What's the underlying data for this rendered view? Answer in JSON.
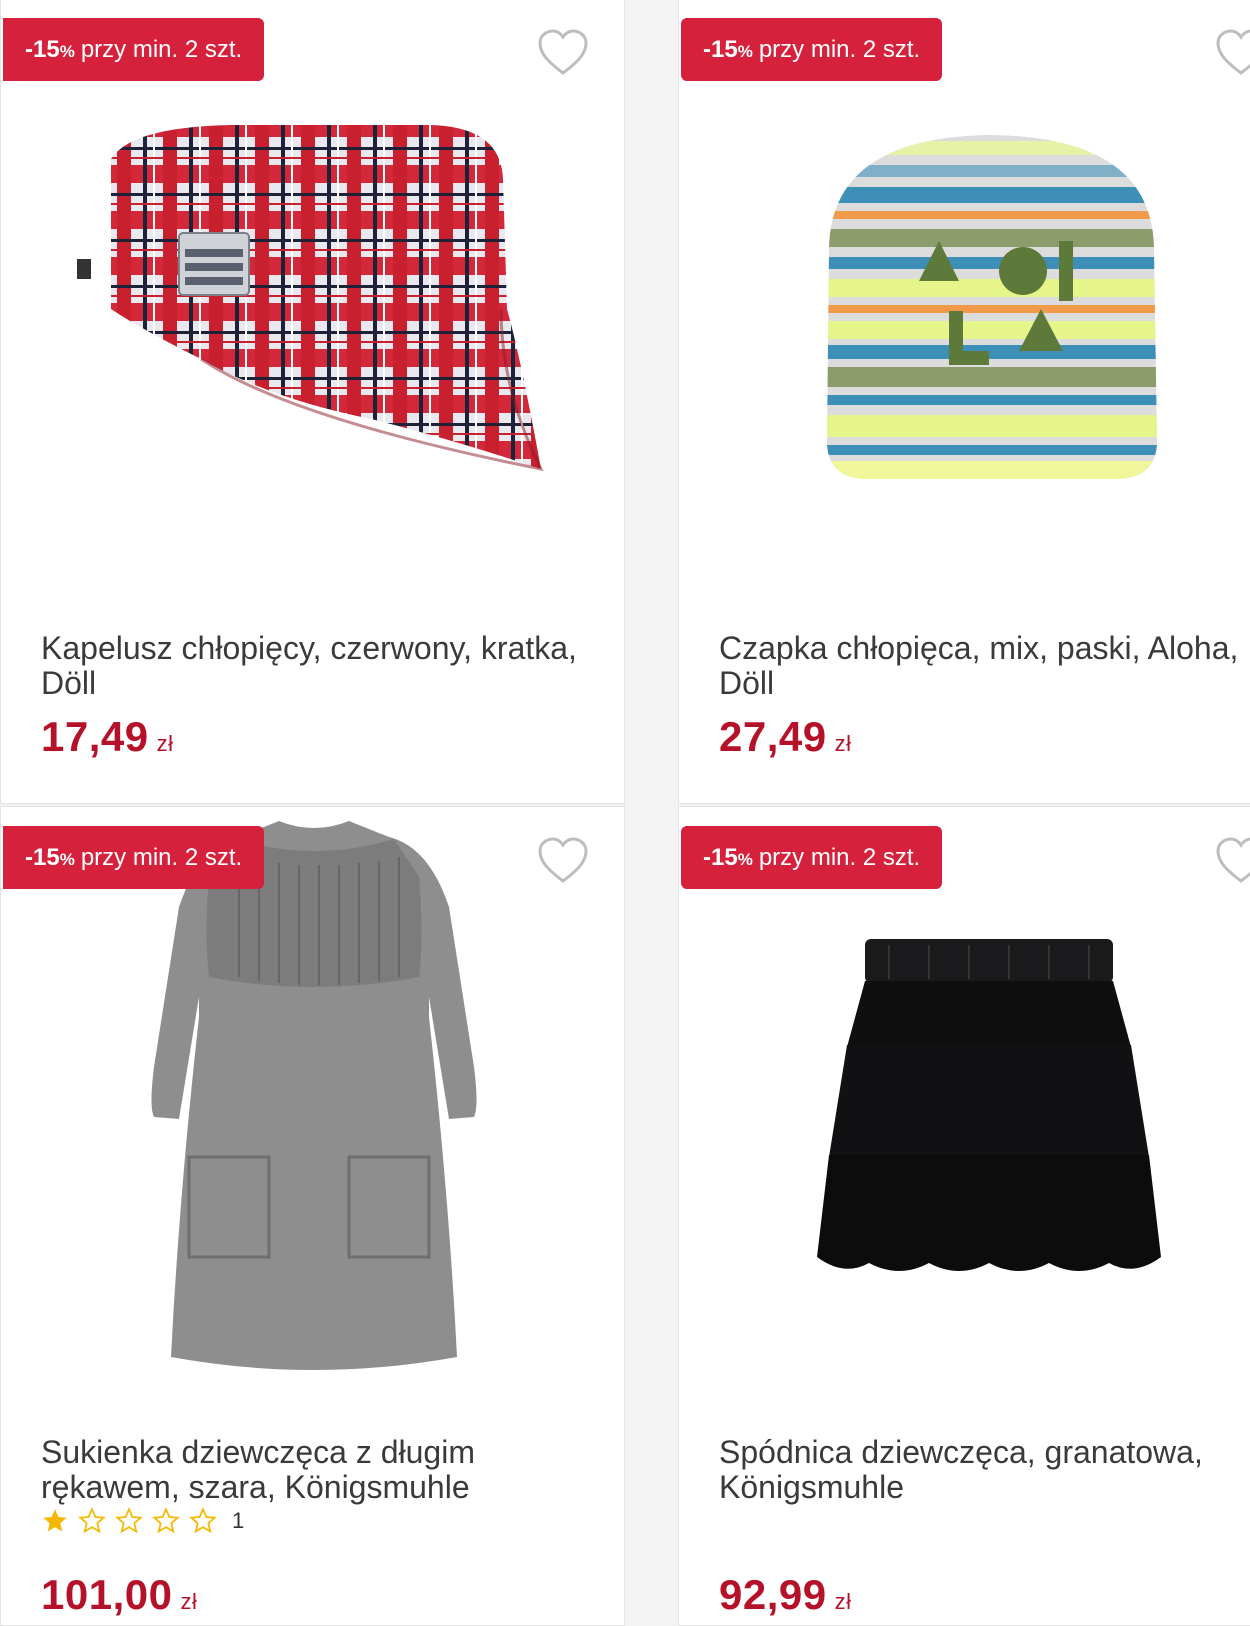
{
  "products": [
    {
      "badge": {
        "pct": "-15",
        "sign": "%",
        "text": "przy min. 2 szt."
      },
      "title": "Kapelusz chłopięcy, czerwony, kratka, Döll",
      "price": "17,49",
      "currency": "zł",
      "image": "plaid-hat-image"
    },
    {
      "badge": {
        "pct": "-15",
        "sign": "%",
        "text": "przy min. 2 szt."
      },
      "title": "Czapka chłopięca, mix, paski, Aloha, Döll",
      "price": "27,49",
      "currency": "zł",
      "image": "striped-beanie-image"
    },
    {
      "badge": {
        "pct": "-15",
        "sign": "%",
        "text": "przy min. 2 szt."
      },
      "title": "Sukienka dziewczęca z długim rękawem, szara, Königsmuhle",
      "rating": 1,
      "rating_max": 5,
      "rating_count": "1",
      "price": "101,00",
      "currency": "zł",
      "image": "grey-knit-dress-image"
    },
    {
      "badge": {
        "pct": "-15",
        "sign": "%",
        "text": "przy min. 2 szt."
      },
      "title": "Spódnica dziewczęca, granatowa, Königsmuhle",
      "price": "92,99",
      "currency": "zł",
      "image": "tulle-skirt-image"
    }
  ],
  "colors": {
    "badge": "#d6213c",
    "price": "#b5122a",
    "star": "#f5b800"
  }
}
